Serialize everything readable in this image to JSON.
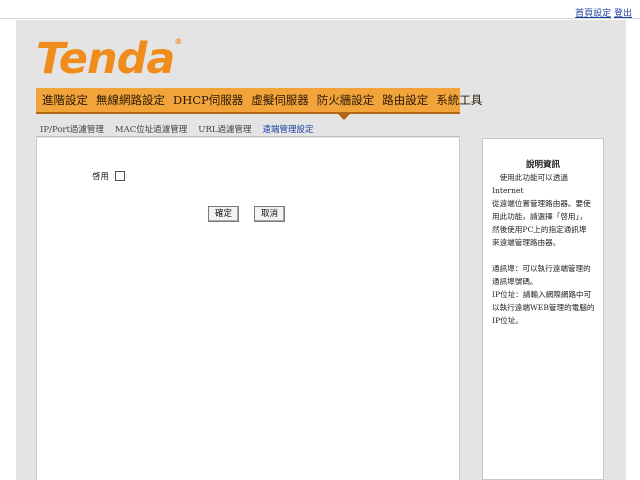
{
  "top_links": {
    "home": "首頁設定",
    "logout": "登出"
  },
  "logo": {
    "text": "Tenda",
    "mark": "®"
  },
  "menu": [
    "進階設定",
    "無線網路設定",
    "DHCP伺服器",
    "虛擬伺服器",
    "防火牆設定",
    "路由設定",
    "系統工具"
  ],
  "submenu": [
    "IP/Port過濾管理",
    "MAC位址過濾管理",
    "URL過濾管理",
    "遠端管理設定"
  ],
  "form": {
    "enable_label": "啓用",
    "enable_checked": false,
    "ok_label": "確定",
    "cancel_label": "取消"
  },
  "help": {
    "title": "說明資訊",
    "lines1": [
      "　使用此功能可以透過Internet",
      "從遠端位置管理路由器。要使",
      "用此功能，請選擇「啓用」，",
      "然後使用PC上的指定通訊埠",
      "來遠端管理路由器。"
    ],
    "lines2": [
      "通訊埠：可以執行遠端管理的",
      "通訊埠號碼。",
      "IP位址：請輸入網際網路中可",
      "以執行遠端WEB管理的電腦的",
      "IP位址。"
    ]
  }
}
